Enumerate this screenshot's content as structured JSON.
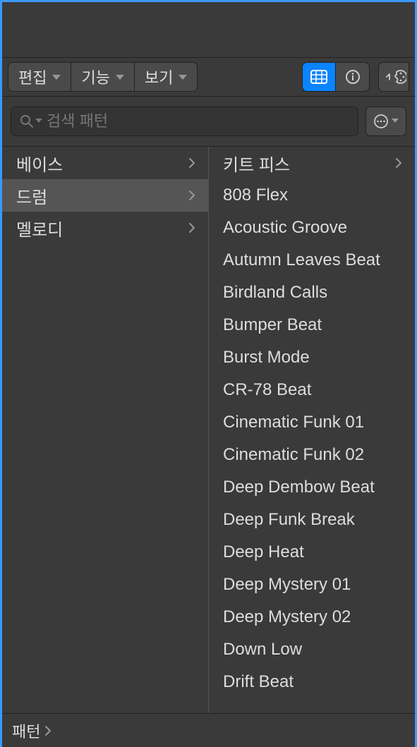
{
  "toolbar": {
    "menus": [
      {
        "label": "편집"
      },
      {
        "label": "기능"
      },
      {
        "label": "보기"
      }
    ]
  },
  "search": {
    "placeholder": "검색 패턴",
    "value": ""
  },
  "categories": [
    {
      "label": "베이스",
      "selected": false,
      "chevron": true
    },
    {
      "label": "드럼",
      "selected": true,
      "chevron": true
    },
    {
      "label": "멜로디",
      "selected": false,
      "chevron": true
    }
  ],
  "patterns": [
    {
      "label": "키트 피스",
      "chevron": true
    },
    {
      "label": "808 Flex",
      "chevron": false
    },
    {
      "label": "Acoustic Groove",
      "chevron": false
    },
    {
      "label": "Autumn Leaves Beat",
      "chevron": false
    },
    {
      "label": "Birdland Calls",
      "chevron": false
    },
    {
      "label": "Bumper Beat",
      "chevron": false
    },
    {
      "label": "Burst Mode",
      "chevron": false
    },
    {
      "label": "CR-78 Beat",
      "chevron": false
    },
    {
      "label": "Cinematic Funk 01",
      "chevron": false
    },
    {
      "label": "Cinematic Funk 02",
      "chevron": false
    },
    {
      "label": "Deep Dembow Beat",
      "chevron": false
    },
    {
      "label": "Deep Funk Break",
      "chevron": false
    },
    {
      "label": "Deep Heat",
      "chevron": false
    },
    {
      "label": "Deep Mystery 01",
      "chevron": false
    },
    {
      "label": "Deep Mystery 02",
      "chevron": false
    },
    {
      "label": "Down Low",
      "chevron": false
    },
    {
      "label": "Drift Beat",
      "chevron": false
    }
  ],
  "footer": {
    "breadcrumb": "패턴"
  }
}
